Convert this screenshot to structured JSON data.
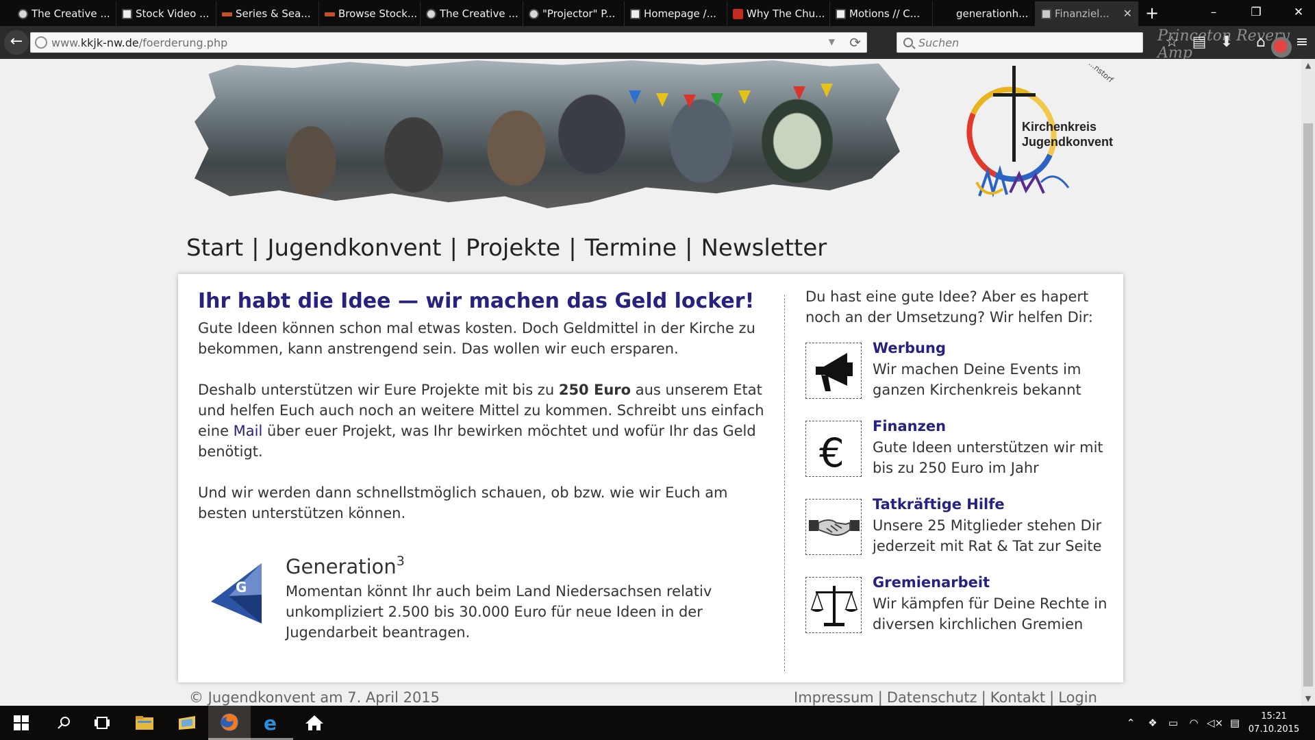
{
  "browser": {
    "tabs": [
      {
        "label": "The Creative ...",
        "icon": "circle-logo-icon"
      },
      {
        "label": "Stock Video ...",
        "icon": "film-icon"
      },
      {
        "label": "Series & Sea...",
        "icon": "wm-logo-icon"
      },
      {
        "label": "Browse Stock...",
        "icon": "wm-logo-icon"
      },
      {
        "label": "The Creative ...",
        "icon": "circle-logo-icon"
      },
      {
        "label": "\"Projector\" P...",
        "icon": "circle-logo-icon"
      },
      {
        "label": "Homepage /...",
        "icon": "page-icon"
      },
      {
        "label": "Why The Chu...",
        "icon": "red-logo-icon"
      },
      {
        "label": "Motions // C...",
        "icon": "page-icon"
      },
      {
        "label": "generationh...",
        "icon": "none"
      },
      {
        "label": "Finanziel...",
        "icon": "cross-logo-icon",
        "active": true
      }
    ],
    "new_tab_label": "+",
    "window_controls": {
      "minimize": "–",
      "maximize": "❐",
      "close": "✕"
    },
    "url_prefix": "www.",
    "url_domain": "kkjk-nw.de",
    "url_path": "/foerderung.php",
    "search_placeholder": "Suchen",
    "theme_text": "Princeton Revery Amp"
  },
  "site": {
    "logo_text_line1": "Kirchenkreis",
    "logo_text_line2": "Jugendkonvent",
    "logo_arc_text": "...nstorf",
    "nav": [
      "Start",
      "Jugendkonvent",
      "Projekte",
      "Termine",
      "Newsletter"
    ],
    "nav_separator": "|",
    "headline": "Ihr habt die Idee — wir machen das Geld locker!",
    "intro": "Gute Ideen können schon mal etwas kosten. Doch Geldmittel in der Kirche zu bekommen, kann anstrengend sein. Das wollen wir euch ersparen.",
    "support_pre": "Deshalb unterstützen wir Eure Projekte mit bis zu ",
    "support_amount": "250 Euro",
    "support_mid": " aus unserem Etat und helfen Euch auch noch an weitere Mittel zu kommen. Schreibt uns einfach eine ",
    "support_link": "Mail",
    "support_post": " über euer Projekt, was Ihr bewirken möchtet und wofür Ihr das Geld benötigt.",
    "followup": "Und wir werden dann schnellstmöglich schauen, ob bzw. wie wir Euch am besten unterstützen können.",
    "generation_title": "Generation",
    "generation_sup": "3",
    "generation_logo_letter": "G",
    "generation_text": "Momentan könnt Ihr auch beim Land Niedersachsen relativ unkompliziert 2.500 bis 30.000 Euro für neue Ideen in der Jugendarbeit beantragen.",
    "aside_intro": "Du hast eine gute Idee? Aber es hapert noch an der Umsetzung? Wir helfen Dir:",
    "features": [
      {
        "title": "Werbung",
        "text": "Wir machen Deine Events im ganzen Kirchenkreis bekannt",
        "icon": "megaphone-icon"
      },
      {
        "title": "Finanzen",
        "text": "Gute Ideen unterstützen wir mit bis zu 250 Euro im Jahr",
        "icon": "euro-icon"
      },
      {
        "title": "Tatkräftige Hilfe",
        "text": "Unsere 25 Mitglieder stehen Dir jederzeit mit Rat & Tat zur Seite",
        "icon": "handshake-icon"
      },
      {
        "title": "Gremienarbeit",
        "text": "Wir kämpfen für Deine Rechte in diversen kirchlichen Gremien",
        "icon": "scales-icon"
      }
    ],
    "footer_copyright": "© Jugendkonvent am 7. April 2015",
    "footer_links": [
      "Impressum",
      "Datenschutz",
      "Kontakt",
      "Login"
    ],
    "colors": {
      "link": "#26227e",
      "text": "#333333",
      "page_bg": "#f0f0f0"
    }
  },
  "taskbar": {
    "apps": [
      "start-icon",
      "search-icon",
      "task-view-icon",
      "file-explorer-icon",
      "folder-icon",
      "firefox-icon",
      "edge-icon",
      "home-icon"
    ],
    "time": "15:21",
    "date": "07.10.2015"
  }
}
